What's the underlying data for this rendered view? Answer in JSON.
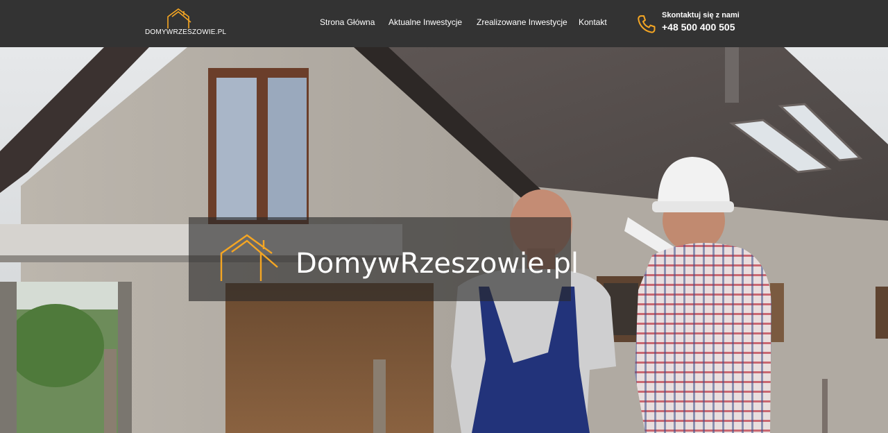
{
  "header": {
    "logo_text": "DOMYWRZESZOWIE.PL",
    "nav": [
      {
        "label": "Strona Główna"
      },
      {
        "label": "Aktualne Inwestycje"
      },
      {
        "label": "Zrealizowane Inwestycje"
      },
      {
        "label": "Kontakt"
      }
    ],
    "contact": {
      "cta": "Skontaktuj się z nami",
      "phone": "+48 500 400 505",
      "icon": "phone-icon"
    }
  },
  "hero": {
    "title": "DomywRzeszowie.pl",
    "logo_icon": "house-logo-icon",
    "image": "two-workers-in-front-of-house-under-construction"
  },
  "colors": {
    "accent": "#F5A623",
    "header_bg": "#333333",
    "text": "#FFFFFF"
  }
}
